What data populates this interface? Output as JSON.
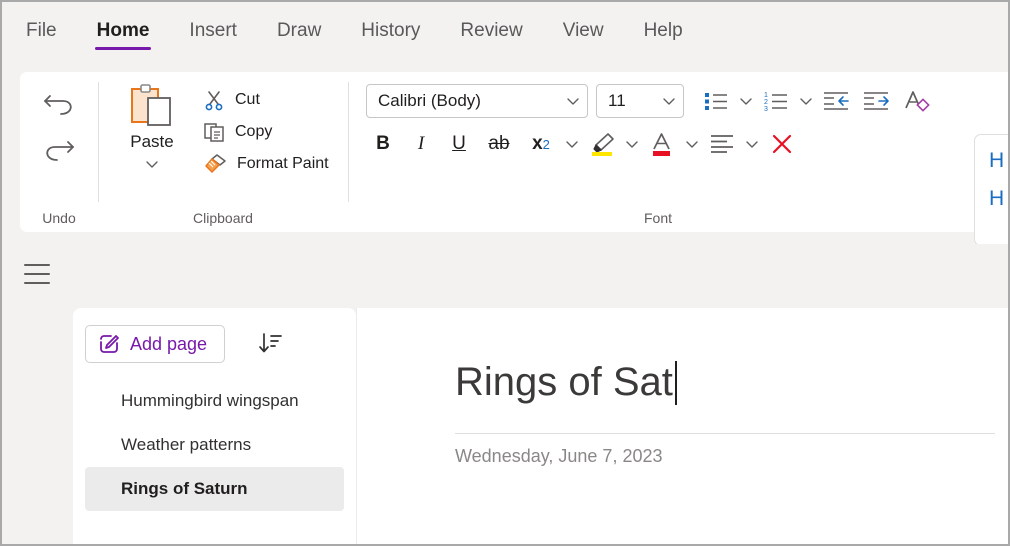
{
  "colors": {
    "accent_purple": "#7719aa",
    "blue": "#1a6ec1",
    "orange": "#e8761c",
    "red": "#e81123",
    "yellow": "#ffe600",
    "selected_bg": "#ebebeb"
  },
  "ribbon": {
    "tabs": [
      {
        "label": "File",
        "active": false
      },
      {
        "label": "Home",
        "active": true
      },
      {
        "label": "Insert",
        "active": false
      },
      {
        "label": "Draw",
        "active": false
      },
      {
        "label": "History",
        "active": false
      },
      {
        "label": "Review",
        "active": false
      },
      {
        "label": "View",
        "active": false
      },
      {
        "label": "Help",
        "active": false
      }
    ],
    "groups": {
      "undo": {
        "label": "Undo",
        "undo_icon": "undo-arrow-icon",
        "redo_icon": "redo-arrow-icon"
      },
      "clipboard": {
        "label": "Clipboard",
        "paste_label": "Paste",
        "paste_icon": "paste-clipboard-icon",
        "items": [
          {
            "label": "Cut",
            "icon": "scissors-icon"
          },
          {
            "label": "Copy",
            "icon": "copy-pages-icon"
          },
          {
            "label": "Format Paint",
            "icon": "format-painter-icon"
          }
        ]
      },
      "font": {
        "label": "Font",
        "font_name": "Calibri (Body)",
        "font_size": "11",
        "row1_buttons": [
          {
            "name": "bullets",
            "glyph": "bullet-list-icon"
          },
          {
            "name": "numbering",
            "glyph": "numbered-list-icon"
          },
          {
            "name": "decrease-indent",
            "glyph": "decrease-indent-icon"
          },
          {
            "name": "increase-indent",
            "glyph": "increase-indent-icon"
          },
          {
            "name": "clear-formatting",
            "glyph": "clear-formatting-icon"
          }
        ],
        "row2_buttons": [
          {
            "name": "bold",
            "glyph": "B"
          },
          {
            "name": "italic",
            "glyph": "I"
          },
          {
            "name": "underline",
            "glyph": "U"
          },
          {
            "name": "strikethrough",
            "glyph": "ab"
          },
          {
            "name": "subscript",
            "glyph": "x2"
          },
          {
            "name": "highlight",
            "glyph": "highlighter-icon"
          },
          {
            "name": "font-color",
            "glyph": "font-color-icon"
          },
          {
            "name": "alignment",
            "glyph": "align-icon"
          },
          {
            "name": "remove-formatting",
            "glyph": "red-x-icon"
          }
        ]
      }
    },
    "styles_pane": {
      "items": [
        "H",
        "H"
      ]
    }
  },
  "workspace": {
    "menu_icon": "hamburger-menu-icon",
    "page_list": {
      "add_page_label": "Add page",
      "add_page_icon": "new-page-pencil-icon",
      "sort_icon": "sort-descending-icon",
      "pages": [
        {
          "title": "Hummingbird wingspan",
          "selected": false
        },
        {
          "title": "Weather patterns",
          "selected": false
        },
        {
          "title": "Rings of Saturn",
          "selected": true
        }
      ]
    },
    "canvas": {
      "note_title": "Rings of Sat",
      "note_date": "Wednesday, June 7, 2023"
    }
  }
}
